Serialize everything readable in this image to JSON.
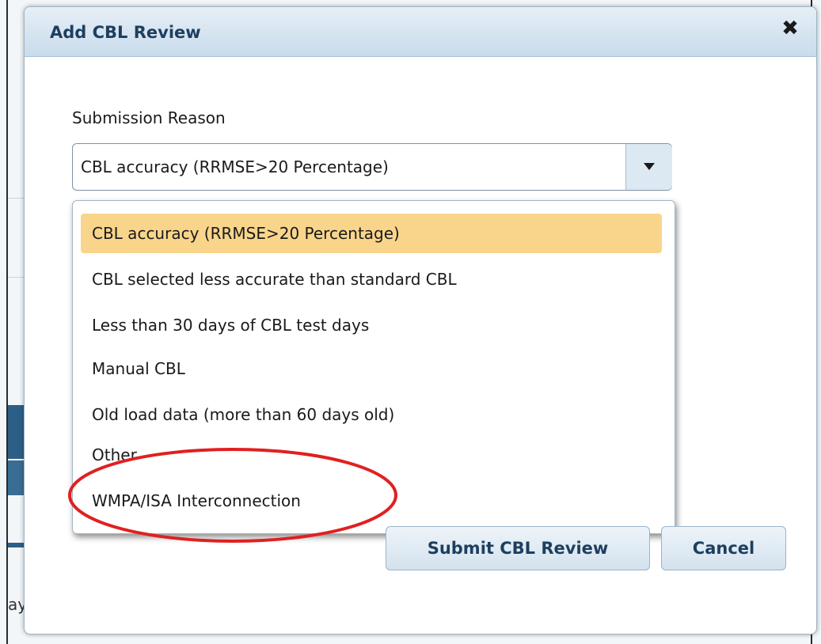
{
  "dialog": {
    "title": "Add CBL Review",
    "close_icon": "close-icon"
  },
  "form": {
    "submission_reason_label": "Submission Reason",
    "selected_value": "CBL accuracy (RRMSE>20 Percentage)",
    "options": [
      "CBL accuracy (RRMSE>20 Percentage)",
      "CBL selected less accurate than standard CBL",
      "Less than 30 days of CBL test days",
      "Manual CBL",
      "Old load data (more than 60 days old)",
      "Other",
      "WMPA/ISA Interconnection"
    ],
    "highlighted_option": "CBL accuracy (RRMSE>20 Percentage)"
  },
  "buttons": {
    "submit_label": "Submit CBL Review",
    "cancel_label": "Cancel"
  },
  "background": {
    "peek_text": "ay"
  },
  "colors": {
    "title_text": "#1d3f5f",
    "option_highlight": "#f9d58b",
    "annotation_ellipse": "#e02020",
    "dialog_header": "#c9dbeb"
  }
}
